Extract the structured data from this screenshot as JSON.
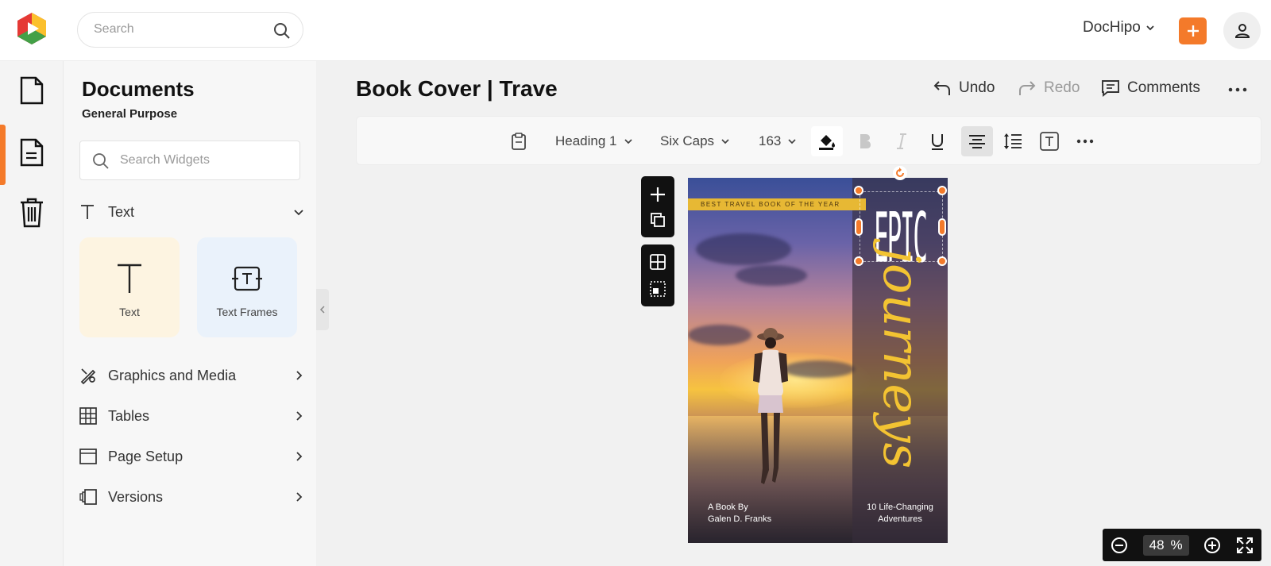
{
  "topbar": {
    "search_placeholder": "Search",
    "account_name": "DocHipo",
    "brand_color": "#f47a2a"
  },
  "rail": {
    "items": [
      {
        "icon": "document-icon"
      },
      {
        "icon": "documents-list-icon",
        "active": true
      },
      {
        "icon": "trash-icon"
      }
    ]
  },
  "sidebar": {
    "title": "Documents",
    "subtitle": "General Purpose",
    "widget_search_placeholder": "Search Widgets",
    "text_section": "Text",
    "tiles": [
      {
        "label": "Text",
        "icon": "text-icon",
        "color": "#fdf4e1"
      },
      {
        "label": "Text Frames",
        "icon": "text-frame-icon",
        "color": "#eaf2fb"
      }
    ],
    "sections": [
      {
        "label": "Graphics and Media",
        "icon": "graphics-icon"
      },
      {
        "label": "Tables",
        "icon": "table-icon"
      },
      {
        "label": "Page Setup",
        "icon": "page-setup-icon"
      },
      {
        "label": "Versions",
        "icon": "versions-icon"
      }
    ]
  },
  "document": {
    "title": "Book Cover | Trave",
    "undo_label": "Undo",
    "redo_label": "Redo",
    "comments_label": "Comments"
  },
  "toolbar": {
    "style": "Heading 1",
    "font": "Six Caps",
    "font_size": "163"
  },
  "cover": {
    "ribbon": "BEST TRAVEL BOOK OF THE YEAR",
    "title_top": "EPIC",
    "title_script": "journeys",
    "author_line1": "A Book By",
    "author_line2": "Galen D. Franks",
    "tagline_line1": "10 Life-Changing",
    "tagline_line2": "Adventures",
    "accent_color": "#f3c332"
  },
  "zoom": {
    "value": "48",
    "unit": "%"
  }
}
